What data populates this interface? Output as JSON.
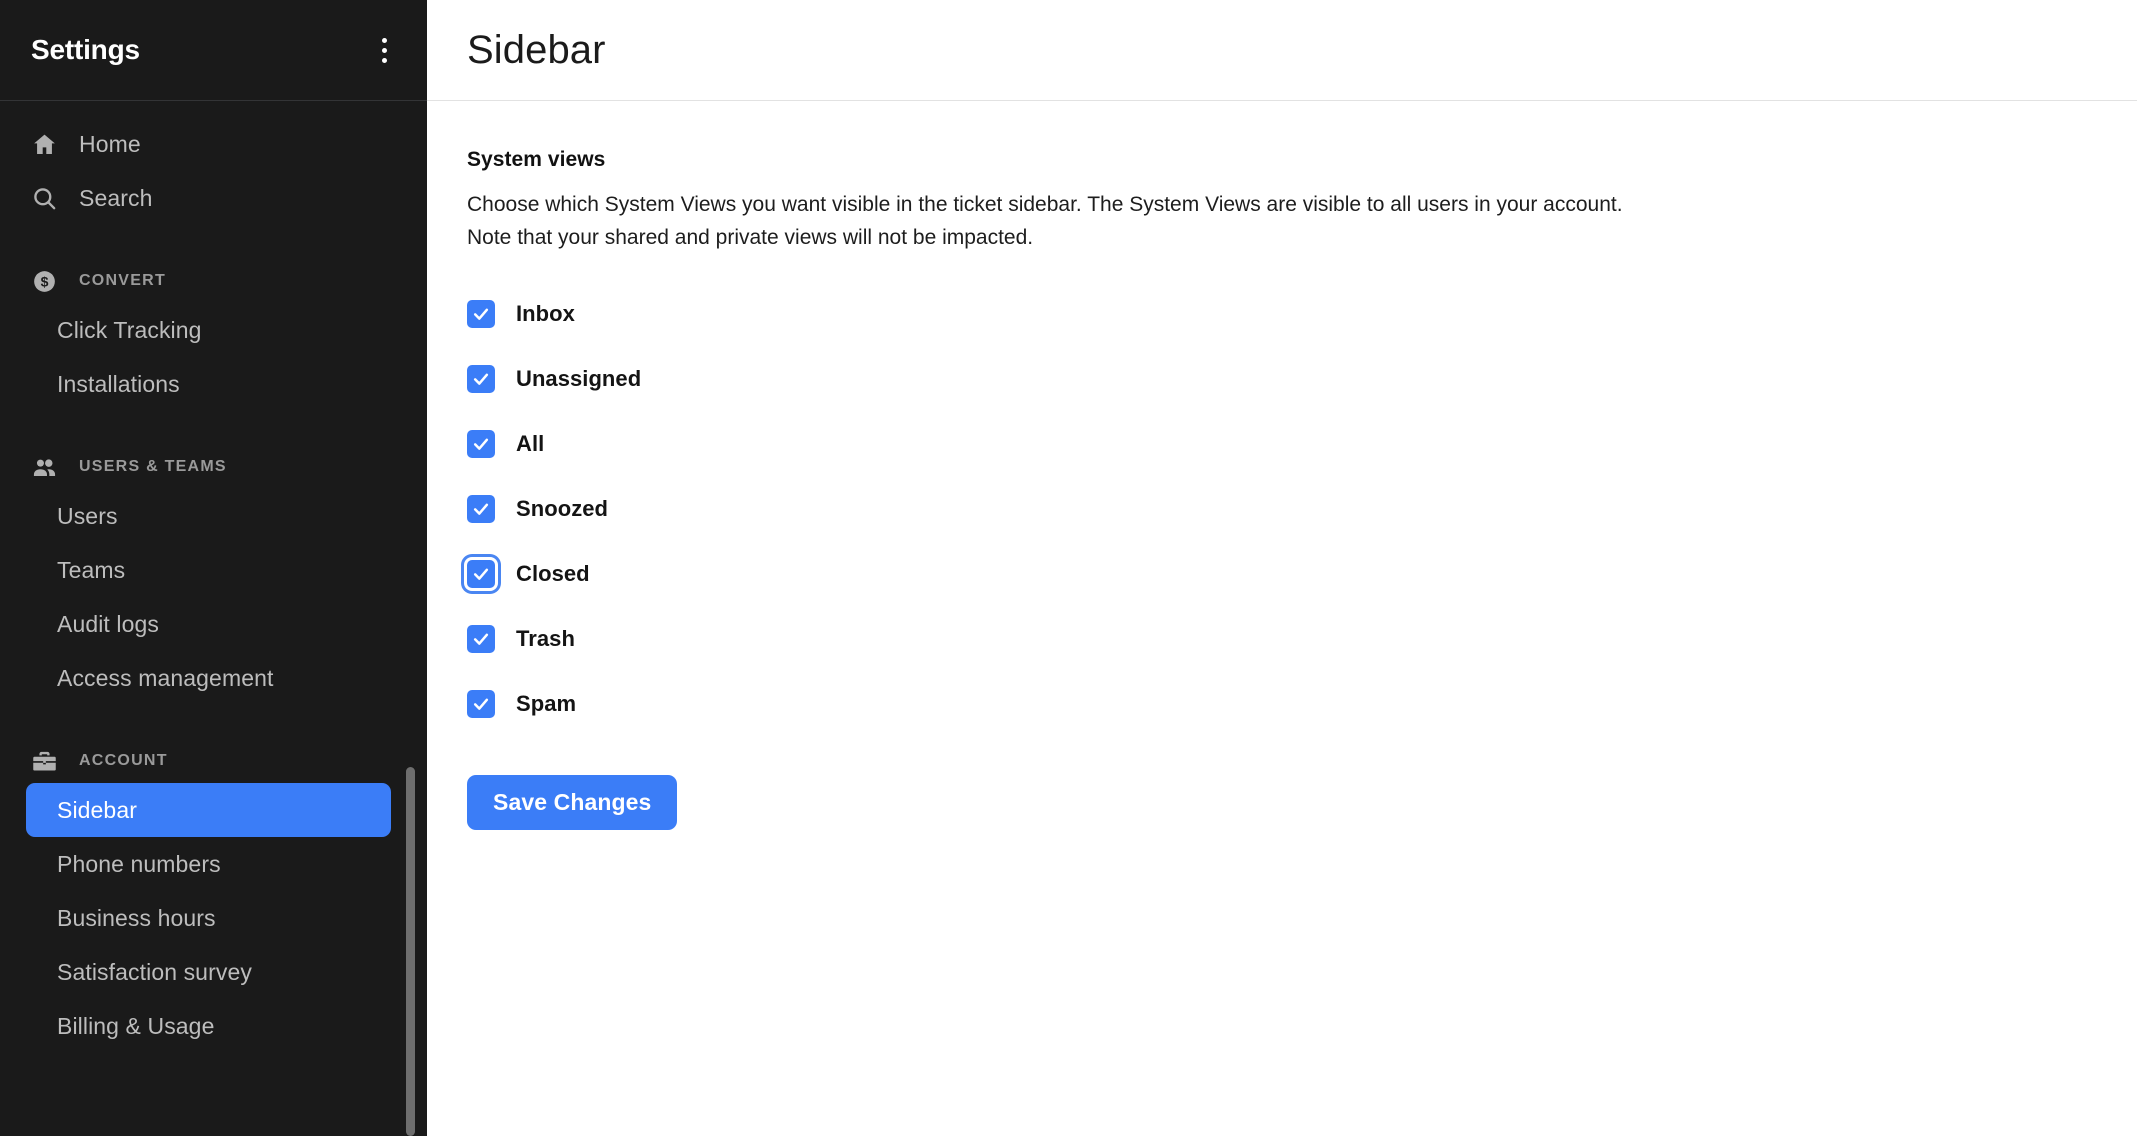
{
  "sidebar": {
    "title": "Settings",
    "menu_icon": "kebab-menu-icon",
    "nav": [
      {
        "label": "Home",
        "icon": "home-icon"
      },
      {
        "label": "Search",
        "icon": "search-icon"
      }
    ],
    "sections": [
      {
        "label": "CONVERT",
        "icon": "dollar-circle-icon",
        "items": [
          {
            "label": "Click Tracking",
            "active": false
          },
          {
            "label": "Installations",
            "active": false
          }
        ]
      },
      {
        "label": "USERS & TEAMS",
        "icon": "people-icon",
        "items": [
          {
            "label": "Users",
            "active": false
          },
          {
            "label": "Teams",
            "active": false
          },
          {
            "label": "Audit logs",
            "active": false
          },
          {
            "label": "Access management",
            "active": false
          }
        ]
      },
      {
        "label": "ACCOUNT",
        "icon": "briefcase-icon",
        "items": [
          {
            "label": "Sidebar",
            "active": true
          },
          {
            "label": "Phone numbers",
            "active": false
          },
          {
            "label": "Business hours",
            "active": false
          },
          {
            "label": "Satisfaction survey",
            "active": false
          },
          {
            "label": "Billing & Usage",
            "active": false
          }
        ]
      }
    ]
  },
  "main": {
    "page_title": "Sidebar",
    "section_title": "System views",
    "description_line_1": "Choose which System Views you want visible in the ticket sidebar. The System Views are visible to all users in your account.",
    "description_line_2": "Note that your shared and private views will not be impacted.",
    "checkboxes": [
      {
        "label": "Inbox",
        "checked": true,
        "focused": false
      },
      {
        "label": "Unassigned",
        "checked": true,
        "focused": false
      },
      {
        "label": "All",
        "checked": true,
        "focused": false
      },
      {
        "label": "Snoozed",
        "checked": true,
        "focused": false
      },
      {
        "label": "Closed",
        "checked": true,
        "focused": true
      },
      {
        "label": "Trash",
        "checked": true,
        "focused": false
      },
      {
        "label": "Spam",
        "checked": true,
        "focused": false
      }
    ],
    "save_label": "Save Changes"
  },
  "colors": {
    "accent_blue": "#3b7df7",
    "sidebar_bg": "#1a1a1a",
    "sidebar_text": "#bdbdbd",
    "section_text": "#9a9a9a"
  }
}
